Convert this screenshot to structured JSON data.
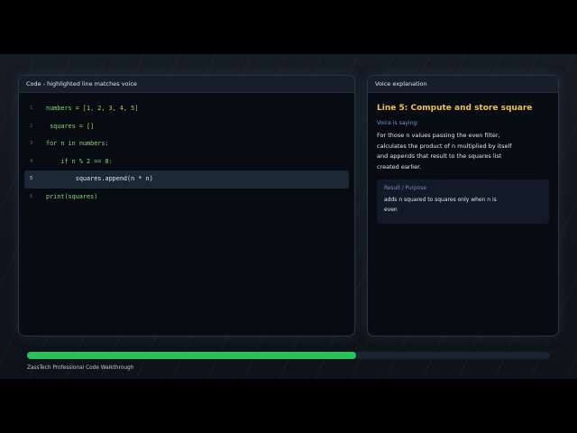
{
  "code_panel": {
    "header": "Code - highlighted line matches voice",
    "lines": [
      {
        "num": "1",
        "code": "numbers = [1, 2, 3, 4, 5]",
        "active": false
      },
      {
        "num": "2",
        "code": " squares = []",
        "active": false
      },
      {
        "num": "3",
        "code": "for n in numbers:",
        "active": false
      },
      {
        "num": "4",
        "code": "    if n % 2 == 0:",
        "active": false
      },
      {
        "num": "5",
        "code": "        squares.append(n * n)",
        "active": true
      },
      {
        "num": "6",
        "code": "print(squares)",
        "active": false
      }
    ]
  },
  "voice_panel": {
    "header": "Voice explanation",
    "title": "Line 5: Compute and store square",
    "saying_label": "Voice is saying:",
    "text": "For those n values passing the even filter, calculates the product of n multiplied by itself and appends that result to the squares list created earlier.",
    "result_label": "Result / Purpose",
    "result_text": "adds n squared to squares only when n is even"
  },
  "progress": {
    "fraction": 0.63
  },
  "footer": "ZassTech Professional Code Walkthrough",
  "colors": {
    "accent_title": "#f0c246",
    "progress": "#2bc25b",
    "code_text": "#8fd47a"
  }
}
